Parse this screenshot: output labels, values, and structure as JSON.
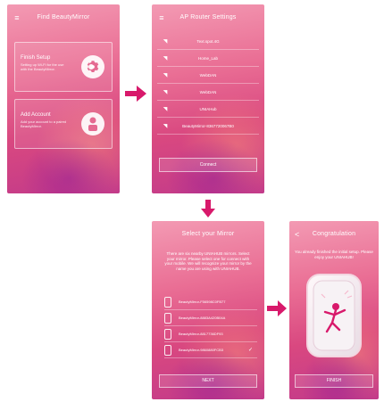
{
  "colors": {
    "accent": "#d8196b",
    "bg_top": "#f39ab3",
    "bg_mid": "#d94880",
    "bg_bottom": "#c23a8a"
  },
  "screen1": {
    "title": "Find BeautyMirror",
    "menu_icon": "≡",
    "cards": [
      {
        "title": "Finish Setup",
        "desc": "Setting up Wi-Fi for the use with the BeautyMirror.",
        "icon": "gear-icon"
      },
      {
        "title": "Add Account",
        "desc": "Add your account to a paired BeautyMirror.",
        "icon": "user-icon"
      }
    ]
  },
  "screen2": {
    "title": "AP Router Settings",
    "networks": [
      "Text.spot.4G",
      "Home_Lab",
      "WebDAN",
      "WebDAN",
      "UNIAHub",
      "BeautyMirror-8367720067B0"
    ],
    "connect_label": "Connect"
  },
  "screen3": {
    "title": "Select your Mirror",
    "description": "There are six nearby UNIAHUB mirrors. Select your mirror. Please select one for connect with your mobile. We will recognize your mirror by the name you are using with UNIAHUB.",
    "mirrors": [
      {
        "name": "BeautyMirror-F56598C0FB77",
        "checked": false
      },
      {
        "name": "BeautyMirror-8883A420B04A",
        "checked": false
      },
      {
        "name": "BeautyMirror-8817736DF93",
        "checked": false
      },
      {
        "name": "BeautyMirror-9860880FCB3",
        "checked": true
      }
    ],
    "next_label": "NEXT"
  },
  "screen4": {
    "title": "Congratulation",
    "back_icon": "<",
    "message": "You already finished the initial setup. Please enjoy your UNIAHUB!",
    "finish_label": "FINISH"
  }
}
